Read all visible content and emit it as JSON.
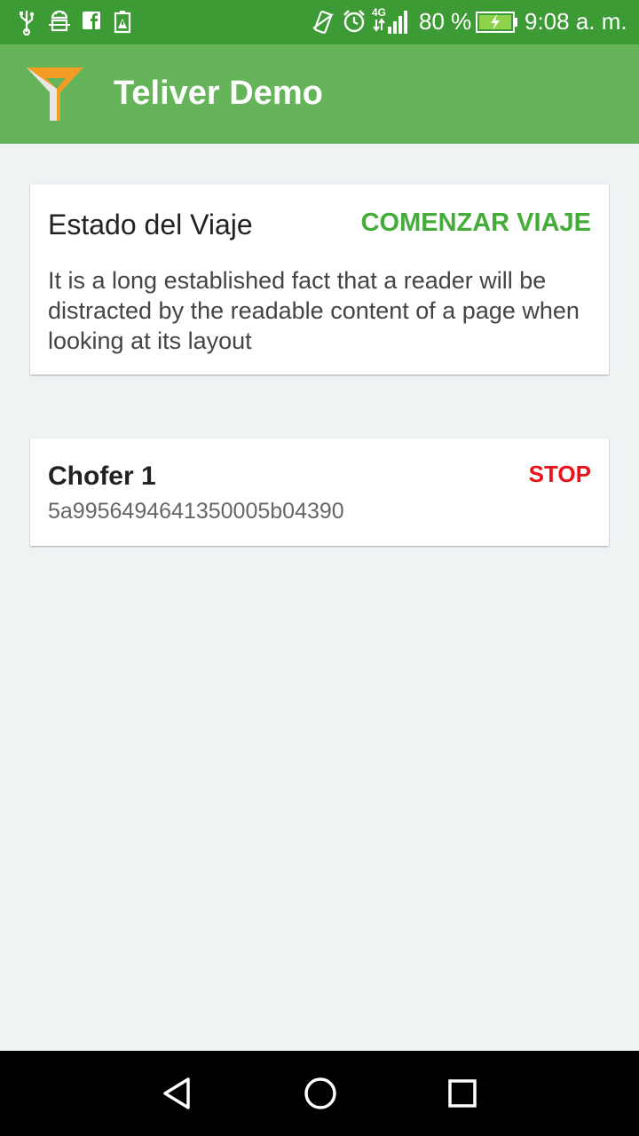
{
  "status_bar": {
    "battery": "80 %",
    "time": "9:08 a. m.",
    "network": "4G",
    "icons_left": [
      "usb-icon",
      "android-debug-icon",
      "facebook-icon",
      "battery-alert-icon"
    ],
    "icons_right": [
      "vibrate-icon",
      "alarm-icon",
      "signal-icon",
      "battery-charging-icon"
    ]
  },
  "app_bar": {
    "title": "Teliver Demo",
    "logo": "teliver-logo"
  },
  "trip_card": {
    "title": "Estado del Viaje",
    "action_label": "COMENZAR VIAJE",
    "description": "It is a long established fact that a reader will be distracted by the readable content of a page when looking at its layout"
  },
  "driver_card": {
    "name": "Chofer 1",
    "id": "5a995649464135000​5b04390",
    "action_label": "STOP"
  },
  "nav_bar": {
    "buttons": [
      "back-icon",
      "home-icon",
      "recents-icon"
    ]
  },
  "colors": {
    "status_bar": "#3d9b35",
    "app_bar": "#66b45a",
    "accent_green": "#44ad3a",
    "stop_red": "#e8141c",
    "background": "#eff3f4"
  }
}
